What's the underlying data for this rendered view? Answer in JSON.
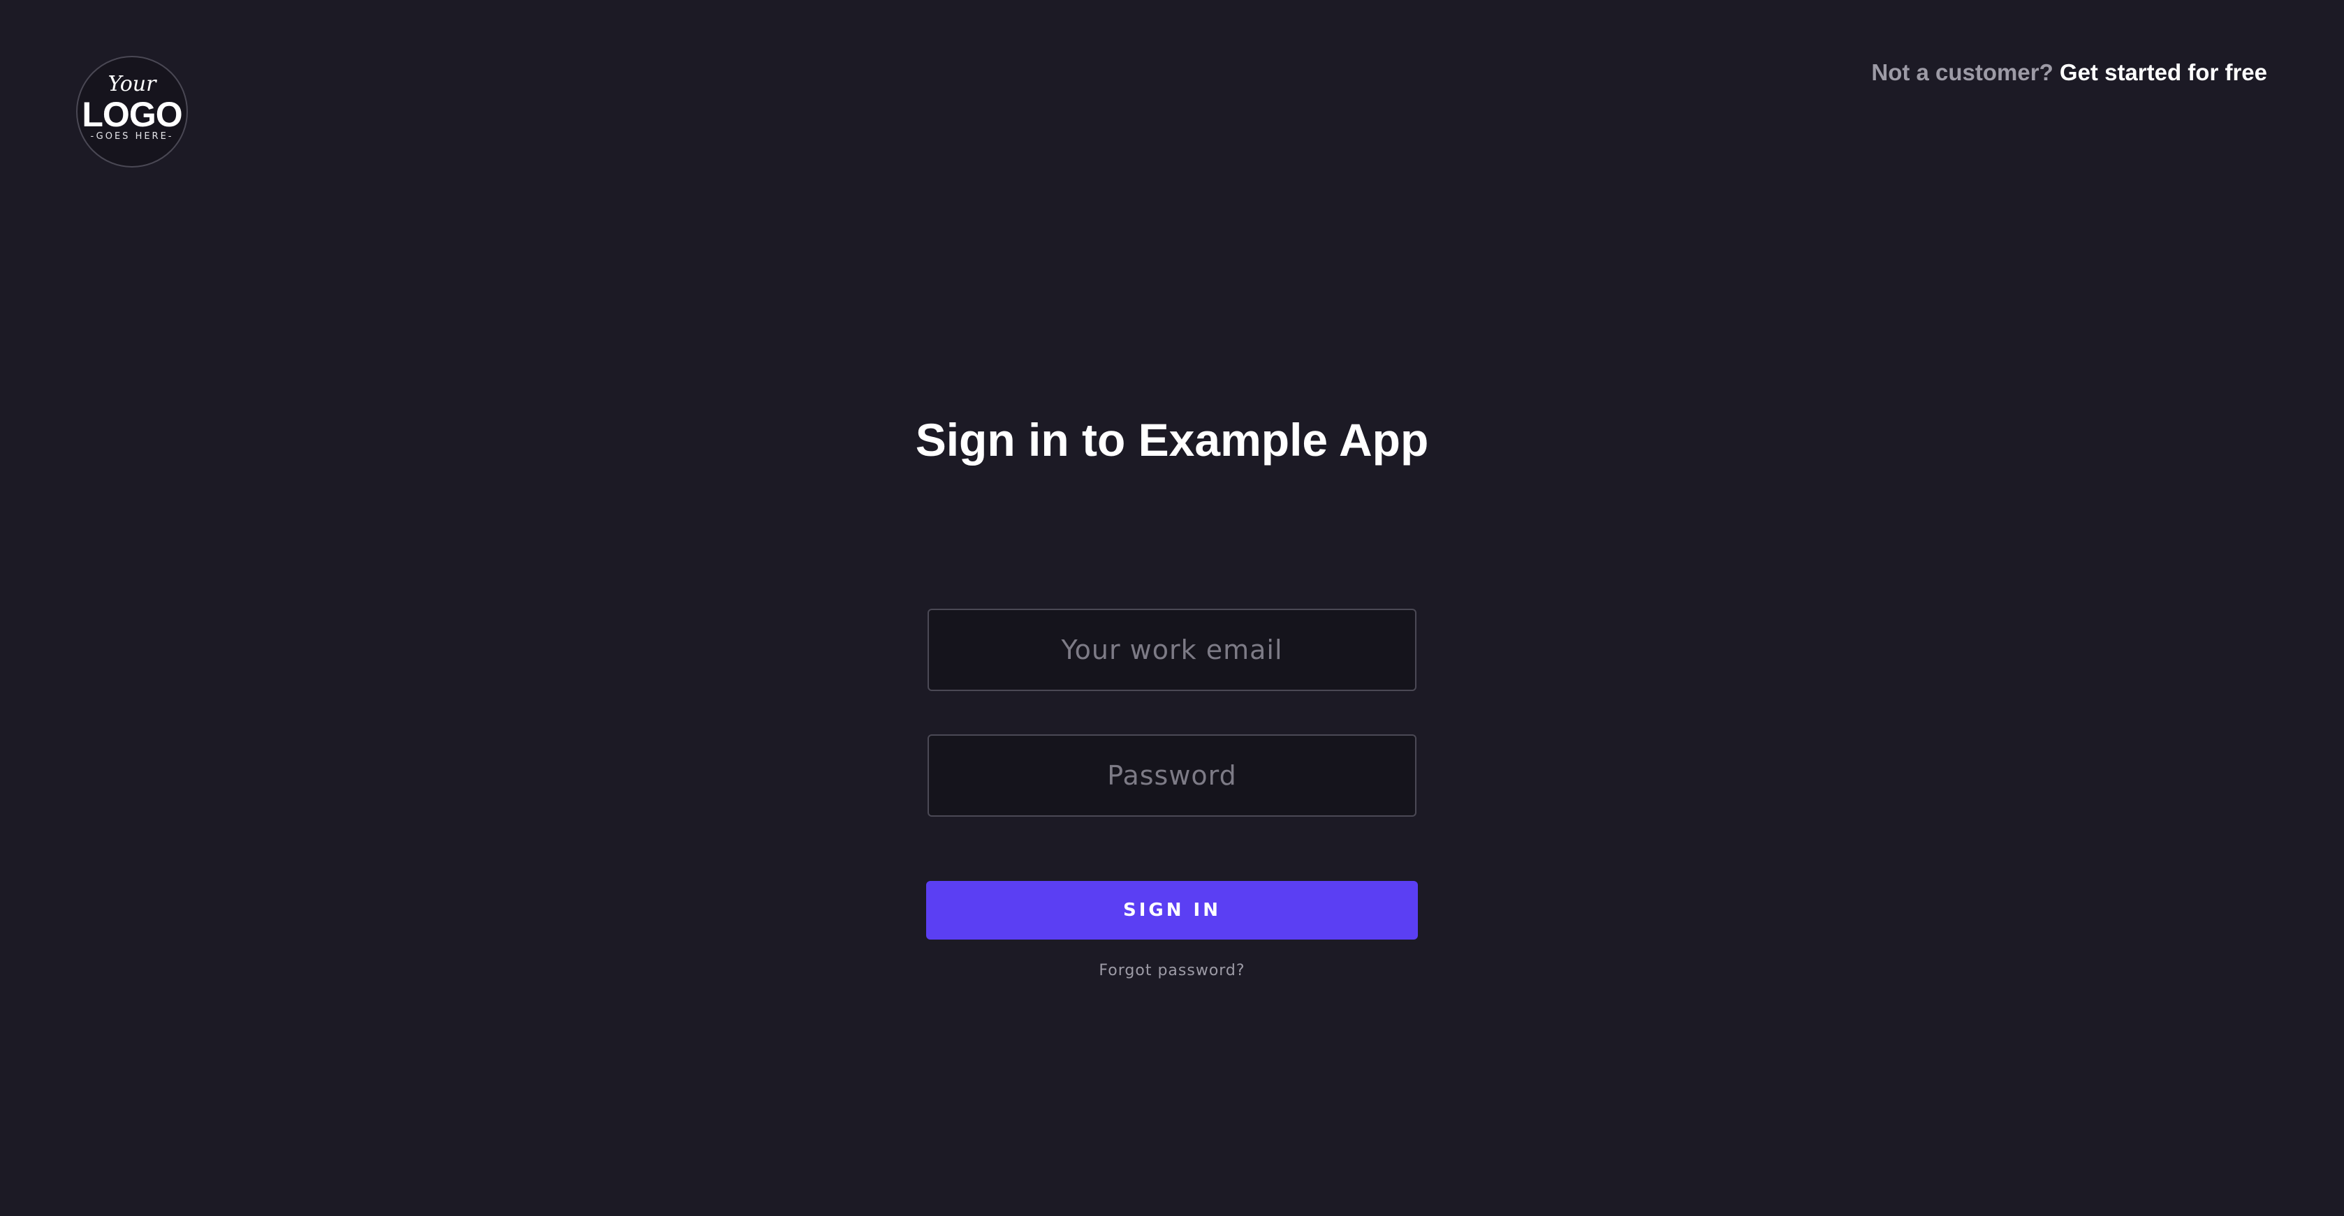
{
  "logo": {
    "line1": "Your",
    "line2": "LOGO",
    "line3": "-GOES HERE-"
  },
  "header": {
    "prompt_text": "Not a customer?",
    "signup_link": "Get started for free"
  },
  "main": {
    "title": "Sign in to Example App",
    "email_placeholder": "Your work email",
    "password_placeholder": "Password",
    "signin_label": "SIGN IN",
    "forgot_label": "Forgot password?"
  },
  "colors": {
    "background": "#1c1a25",
    "accent": "#5b3ff3",
    "muted_text": "#9d9ba6"
  }
}
